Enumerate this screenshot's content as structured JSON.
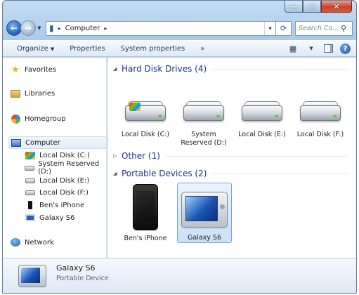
{
  "window": {
    "caption_minimize": "—",
    "caption_maximize": "□",
    "caption_close": "✕"
  },
  "address": {
    "crumb": "Computer",
    "sep1": "▸",
    "sep2": "▸",
    "dropdown": "▾",
    "refresh": "⟳",
    "search_placeholder": "Search Co..."
  },
  "toolbar": {
    "organize": "Organize",
    "properties": "Properties",
    "system_properties": "System properties",
    "more": "»"
  },
  "nav": {
    "favorites": "Favorites",
    "libraries": "Libraries",
    "homegroup": "Homegroup",
    "computer": "Computer",
    "children": [
      "Local Disk (C:)",
      "System Reserved (D:)",
      "Local Disk (E:)",
      "Local Disk (F:)",
      "Ben's iPhone",
      "Galaxy S6"
    ],
    "network": "Network"
  },
  "groups": {
    "hard_disk": "Hard Disk Drives (4)",
    "other": "Other (1)",
    "portable": "Portable Devices (2)"
  },
  "drives": [
    "Local Disk (C:)",
    "System Reserved (D:)",
    "Local Disk (E:)",
    "Local Disk (F:)"
  ],
  "devices": [
    "Ben's iPhone",
    "Galaxy S6"
  ],
  "details": {
    "name": "Galaxy S6",
    "type": "Portable Device"
  },
  "selected_item": "Galaxy S6"
}
